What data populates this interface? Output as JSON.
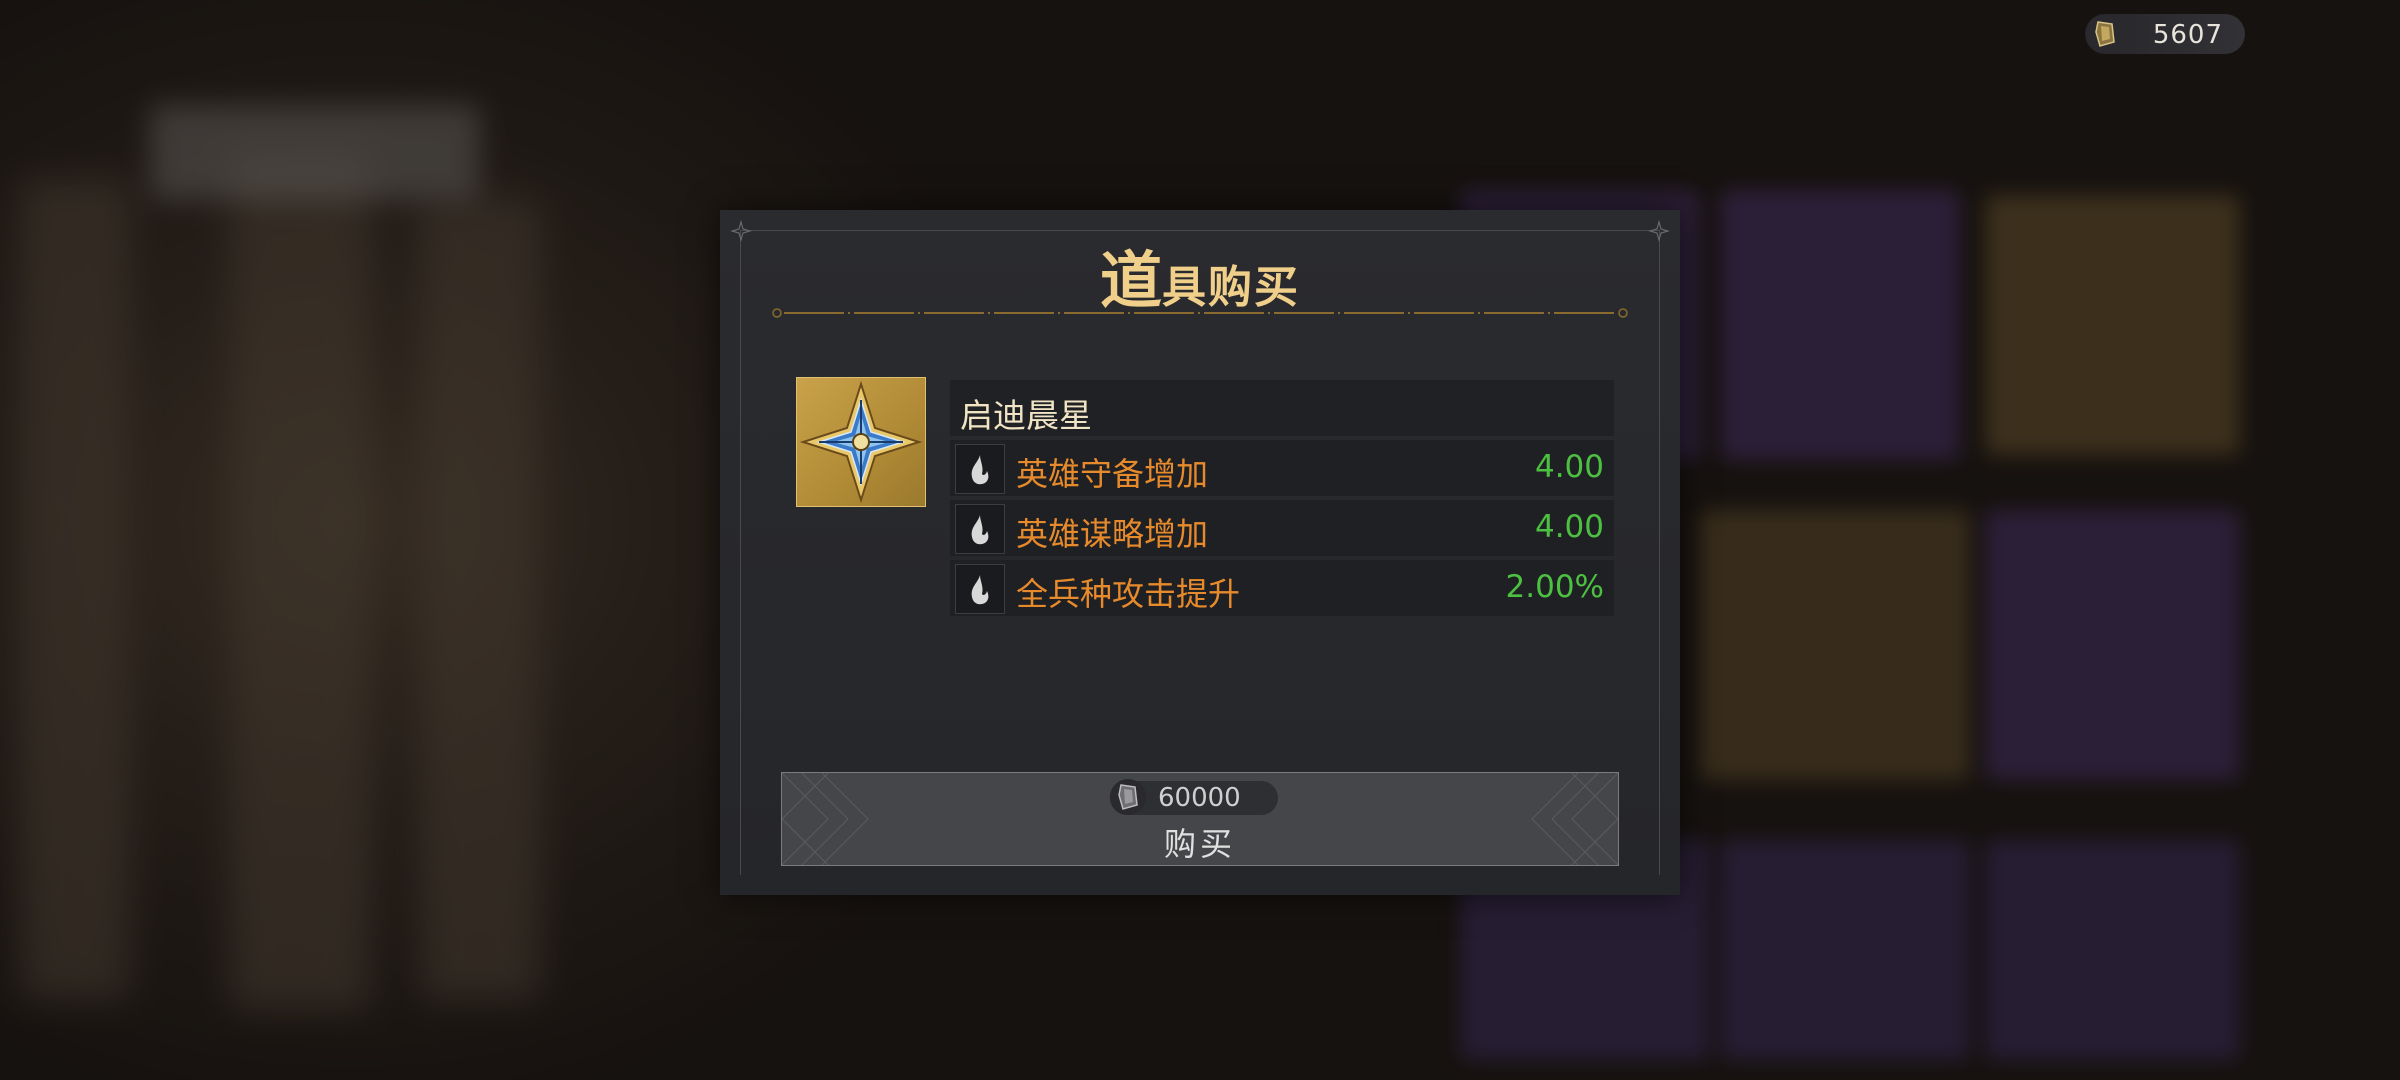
{
  "currency": {
    "amount": "5607",
    "icon": "crystal-coin-icon"
  },
  "dialog": {
    "title_first": "道",
    "title_rest": "具购买",
    "item": {
      "name": "启迪晨星",
      "icon": "four-point-star-gem-icon",
      "stats": [
        {
          "label": "英雄守备增加",
          "value": "4.00",
          "icon": "flame-icon"
        },
        {
          "label": "英雄谋略增加",
          "value": "4.00",
          "icon": "flame-icon"
        },
        {
          "label": "全兵种攻击提升",
          "value": "2.00%",
          "icon": "flame-icon"
        }
      ]
    },
    "buy_button": {
      "price": "60000",
      "label": "购买",
      "icon": "crystal-coin-icon"
    }
  },
  "colors": {
    "title_gold": "#f0cf8a",
    "stat_orange": "#e68a2c",
    "stat_green": "#4cc040",
    "panel_bg": "#2a2b2f"
  }
}
